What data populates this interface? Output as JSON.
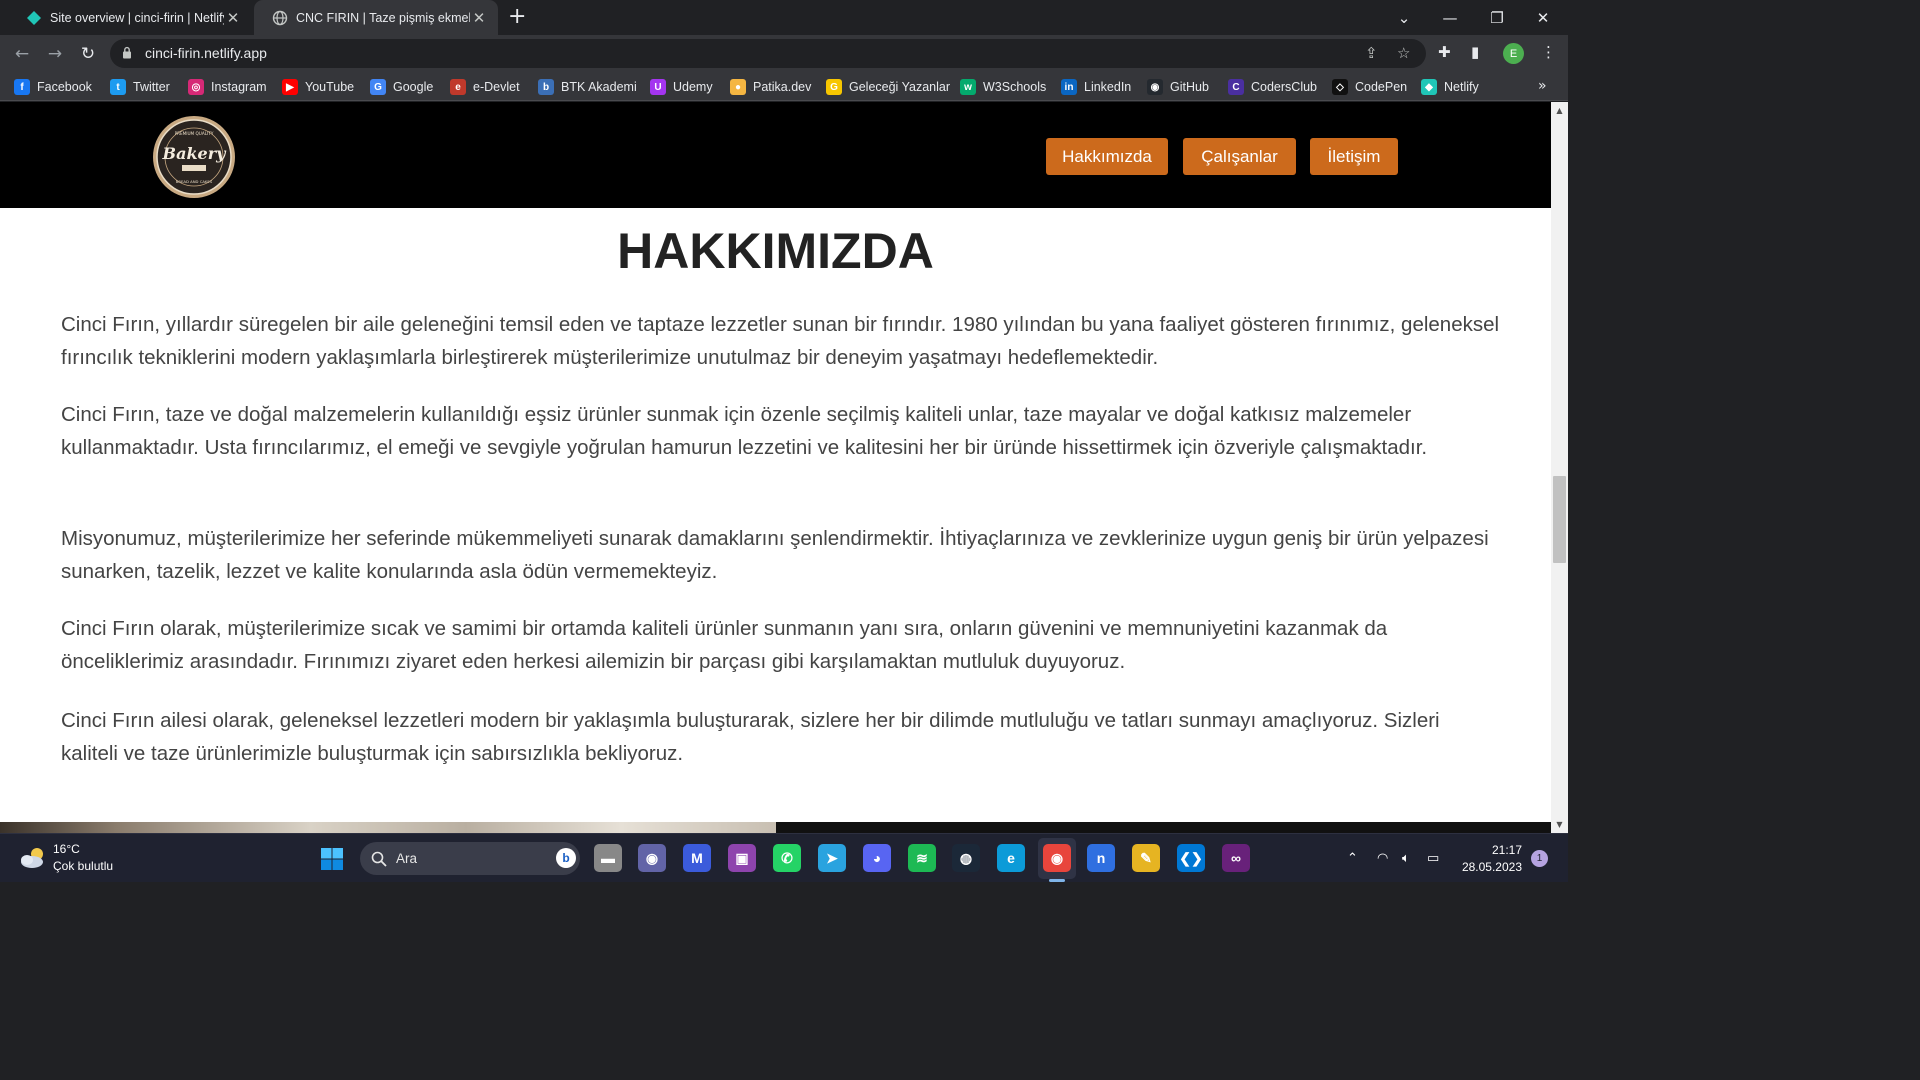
{
  "browser": {
    "tabs": [
      {
        "title": "Site overview | cinci-firin | Netlify",
        "icon": "netlify-icon",
        "active": false
      },
      {
        "title": "CNC FIRIN | Taze pişmiş ekmekler",
        "icon": "globe-icon",
        "active": true
      }
    ],
    "url": "cinci-firin.netlify.app",
    "profile_initial": "E",
    "bookmarks": [
      {
        "label": "Facebook",
        "icon": "facebook-icon",
        "color": "#1877f2",
        "glyph": "f"
      },
      {
        "label": "Twitter",
        "icon": "twitter-icon",
        "color": "#1d9bf0",
        "glyph": "t"
      },
      {
        "label": "Instagram",
        "icon": "instagram-icon",
        "color": "#d62976",
        "glyph": "◎"
      },
      {
        "label": "YouTube",
        "icon": "youtube-icon",
        "color": "#ff0000",
        "glyph": "▶"
      },
      {
        "label": "Google",
        "icon": "google-icon",
        "color": "#4285f4",
        "glyph": "G"
      },
      {
        "label": "e-Devlet",
        "icon": "e-devlet-icon",
        "color": "#c0392b",
        "glyph": "e"
      },
      {
        "label": "BTK Akademi",
        "icon": "btk-akademi-icon",
        "color": "#3b6fb6",
        "glyph": "b"
      },
      {
        "label": "Udemy",
        "icon": "udemy-icon",
        "color": "#a435f0",
        "glyph": "U"
      },
      {
        "label": "Patika.dev",
        "icon": "patika-icon",
        "color": "#f5b642",
        "glyph": "●"
      },
      {
        "label": "Geleceği Yazanlar",
        "icon": "gelecegi-yazanlar-icon",
        "color": "#f7c600",
        "glyph": "G"
      },
      {
        "label": "W3Schools",
        "icon": "w3schools-icon",
        "color": "#04aa6d",
        "glyph": "w"
      },
      {
        "label": "LinkedIn",
        "icon": "linkedin-icon",
        "color": "#0a66c2",
        "glyph": "in"
      },
      {
        "label": "GitHub",
        "icon": "github-icon",
        "color": "#24292f",
        "glyph": "◉"
      },
      {
        "label": "CodersClub",
        "icon": "codersclub-icon",
        "color": "#4a2fa0",
        "glyph": "C"
      },
      {
        "label": "CodePen",
        "icon": "codepen-icon",
        "color": "#111111",
        "glyph": "◇"
      },
      {
        "label": "Netlify",
        "icon": "netlify-icon",
        "color": "#20c6b7",
        "glyph": "◆"
      }
    ]
  },
  "site": {
    "logo": {
      "brand": "Bakery",
      "top_text": "PREMIUM QUALITY",
      "bottom_text": "BREAD AND CAKES"
    },
    "nav": [
      "Hakkımızda",
      "Çalışanlar",
      "İletişim"
    ],
    "nav_color": "#cc6a1c",
    "title": "HAKKIMIZDA",
    "paragraphs": [
      "Cinci Fırın, yıllardır süregelen bir aile geleneğini temsil eden ve taptaze lezzetler sunan bir fırındır. 1980 yılından bu yana faaliyet gösteren fırınımız, geleneksel fırıncılık tekniklerini modern yaklaşımlarla birleştirerek müşterilerimize unutulmaz bir deneyim yaşatmayı hedeflemektedir.",
      "Cinci Fırın, taze ve doğal malzemelerin kullanıldığı eşsiz ürünler sunmak için özenle seçilmiş kaliteli unlar, taze mayalar ve doğal katkısız malzemeler kullanmaktadır. Usta fırıncılarımız, el emeği ve sevgiyle yoğrulan hamurun lezzetini ve kalitesini her bir üründe hissettirmek için özveriyle çalışmaktadır.",
      "Misyonumuz, müşterilerimize her seferinde mükemmeliyeti sunarak damaklarını şenlendirmektir. İhtiyaçlarınıza ve zevklerinize uygun geniş bir ürün yelpazesi sunarken, tazelik, lezzet ve kalite konularında asla ödün vermemekteyiz.",
      "Cinci Fırın olarak, müşterilerimize sıcak ve samimi bir ortamda kaliteli ürünler sunmanın yanı sıra, onların güvenini ve memnuniyetini kazanmak da önceliklerimiz arasındadır. Fırınımızı ziyaret eden herkesi ailemizin bir parçası gibi karşılamaktan mutluluk duyuyoruz.",
      "Cinci Fırın ailesi olarak, geleneksel lezzetleri modern bir yaklaşımla buluşturarak, sizlere her bir dilimde mutluluğu ve tatları sunmayı amaçlıyoruz. Sizleri kaliteli ve taze ürünlerimizle buluşturmak için sabırsızlıkla bekliyoruz."
    ]
  },
  "taskbar": {
    "weather_temp": "16°C",
    "weather_desc": "Çok bulutlu",
    "search_placeholder": "Ara",
    "time": "21:17",
    "date": "28.05.2023",
    "notification_count": "1",
    "apps": [
      {
        "name": "file-explorer-icon",
        "glyph": "▬",
        "color": "#888888"
      },
      {
        "name": "teams-icon",
        "glyph": "◉",
        "color": "#6264a7"
      },
      {
        "name": "clipchamp-icon",
        "glyph": "M",
        "color": "#3b5bdb"
      },
      {
        "name": "video-editor-icon",
        "glyph": "▣",
        "color": "#8e44ad"
      },
      {
        "name": "whatsapp-icon",
        "glyph": "✆",
        "color": "#25d366"
      },
      {
        "name": "telegram-icon",
        "glyph": "➤",
        "color": "#2aa3df"
      },
      {
        "name": "discord-icon",
        "glyph": "◕",
        "color": "#5865f2"
      },
      {
        "name": "spotify-icon",
        "glyph": "≋",
        "color": "#1db954"
      },
      {
        "name": "steam-icon",
        "glyph": "◍",
        "color": "#1b2838"
      },
      {
        "name": "edge-icon",
        "glyph": "e",
        "color": "#0c9bd8"
      },
      {
        "name": "chrome-icon",
        "glyph": "◉",
        "color": "#e8453c"
      },
      {
        "name": "notion-icon",
        "glyph": "n",
        "color": "#2f6fe0"
      },
      {
        "name": "paint-icon",
        "glyph": "✎",
        "color": "#e6b422"
      },
      {
        "name": "vscode-icon",
        "glyph": "❮❯",
        "color": "#0078d4"
      },
      {
        "name": "visual-studio-icon",
        "glyph": "∞",
        "color": "#68217a"
      }
    ]
  }
}
